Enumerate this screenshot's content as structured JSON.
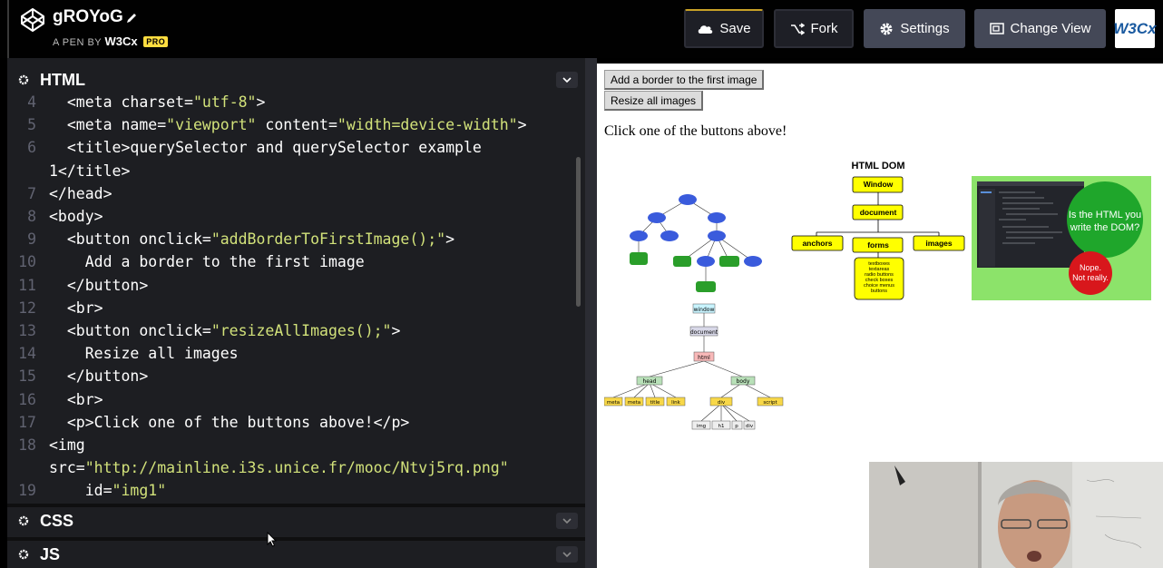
{
  "header": {
    "pen_title": "gROYoG",
    "byline_prefix": "A PEN BY",
    "user": "W3Cx",
    "pro_badge": "PRO",
    "save_label": "Save",
    "fork_label": "Fork",
    "settings_label": "Settings",
    "change_view_label": "Change View",
    "w3c_logo_text": "W3Cx"
  },
  "panels": {
    "html_title": "HTML",
    "css_title": "CSS",
    "js_title": "JS"
  },
  "code_lines": [
    {
      "n": "4",
      "t": "  <meta charset=\"utf-8\">"
    },
    {
      "n": "5",
      "t": "  <meta name=\"viewport\" content=\"width=device-width\">"
    },
    {
      "n": "6",
      "t": "  <title>querySelector and querySelector example"
    },
    {
      "n": "",
      "t": "1</title>"
    },
    {
      "n": "7",
      "t": "</head>"
    },
    {
      "n": "8",
      "t": "<body>"
    },
    {
      "n": "9",
      "t": "  <button onclick=\"addBorderToFirstImage();\">"
    },
    {
      "n": "10",
      "t": "    Add a border to the first image"
    },
    {
      "n": "11",
      "t": "  </button>"
    },
    {
      "n": "12",
      "t": "  <br>"
    },
    {
      "n": "13",
      "t": "  <button onclick=\"resizeAllImages();\">"
    },
    {
      "n": "14",
      "t": "    Resize all images"
    },
    {
      "n": "15",
      "t": "  </button>"
    },
    {
      "n": "16",
      "t": "  <br>"
    },
    {
      "n": "17",
      "t": "  <p>Click one of the buttons above!</p>"
    },
    {
      "n": "18",
      "t": "<img"
    },
    {
      "n": "",
      "t": "src=\"http://mainline.i3s.unice.fr/mooc/Ntvj5rq.png\""
    },
    {
      "n": "19",
      "t": "    id=\"img1\""
    }
  ],
  "preview": {
    "button1": "Add a border to the first image",
    "button2": "Resize all images",
    "paragraph": "Click one of the buttons above!",
    "dom_title": "HTML DOM",
    "dom_nodes": {
      "window": "Window",
      "document": "document",
      "anchors": "anchors",
      "forms": "forms",
      "images": "images",
      "form_items": [
        "textboxes",
        "textareas",
        "radio buttons",
        "check boxes",
        "choice menus",
        "buttons"
      ]
    },
    "tree_labels": {
      "window": "window",
      "document": "document",
      "html": "html",
      "head": "head",
      "body": "body",
      "meta1": "meta",
      "meta2": "meta",
      "title": "title",
      "link": "link",
      "div": "div",
      "script": "script",
      "img": "img",
      "h1": "h1",
      "p": "p",
      "div2": "div"
    },
    "bubble_question": "Is the HTML you write the DOM?",
    "bubble_answer": "Nope. Not really."
  },
  "error_badge": "!"
}
